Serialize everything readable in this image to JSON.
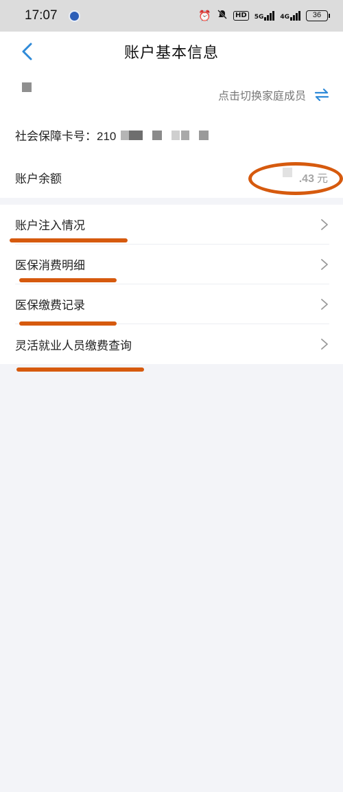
{
  "status_bar": {
    "time": "17:07",
    "net1": "5G",
    "net2": "4G",
    "hd_label": "HD",
    "battery": "36"
  },
  "nav": {
    "title": "账户基本信息"
  },
  "account": {
    "switch_member_label": "点击切换家庭成员",
    "card_no_label": "社会保障卡号：",
    "card_no_prefix": "210",
    "balance_label": "账户余额",
    "balance_amount": ".43",
    "balance_unit": "元"
  },
  "menu": {
    "items": [
      {
        "label": "账户注入情况"
      },
      {
        "label": "医保消费明细"
      },
      {
        "label": "医保缴费记录"
      },
      {
        "label": "灵活就业人员缴费查询"
      }
    ]
  },
  "colors": {
    "accent": "#2f8ad8",
    "annotation": "#d65a0e",
    "background": "#f3f4f8"
  }
}
